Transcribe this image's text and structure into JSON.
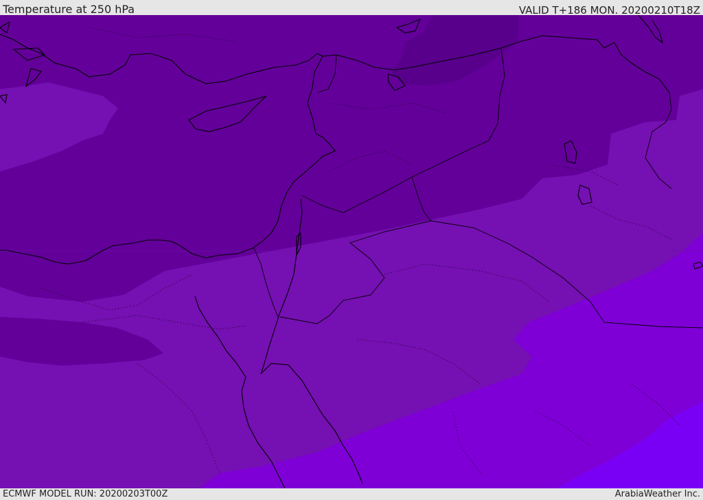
{
  "header": {
    "title": "Temperature at 250 hPa",
    "valid": "VALID T+186 MON. 20200210T18Z"
  },
  "footer": {
    "model_run": "ECMWF MODEL RUN: 20200203T00Z",
    "credit": "ArabiaWeather Inc."
  },
  "map": {
    "fill_colors": {
      "darkest": "#58008c",
      "dark": "#63009a",
      "medium": "#7510b2",
      "bright": "#7e00d6",
      "brightest": "#7a00f5"
    },
    "line_color": "#000000"
  }
}
